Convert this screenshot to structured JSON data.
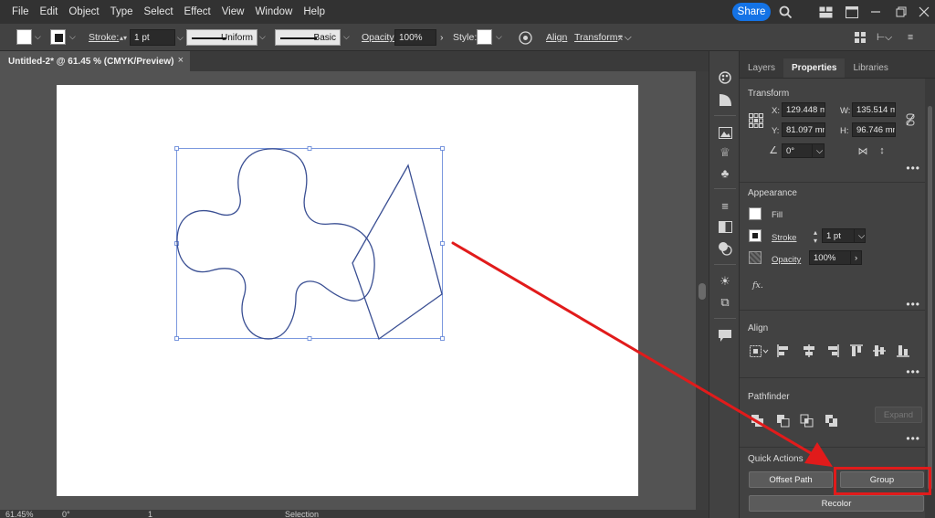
{
  "menu": {
    "items": [
      "File",
      "Edit",
      "Object",
      "Type",
      "Select",
      "Effect",
      "View",
      "Window",
      "Help"
    ],
    "share_label": "Share",
    "icons": [
      "search-icon",
      "arrange-documents-icon",
      "maximize-icon",
      "minimize-icon",
      "restore-icon",
      "close-icon"
    ]
  },
  "control_bar": {
    "stroke_label": "Stroke:",
    "stroke_weight": "1 pt",
    "profile": "Uniform",
    "brush": "Basic",
    "opacity_label": "Opacity:",
    "opacity_value": "100%",
    "style_label": "Style:",
    "align_label": "Align",
    "transform_label": "Transform"
  },
  "document": {
    "tab_title": "Untitled-2* @ 61.45 % (CMYK/Preview)",
    "close_glyph": "×"
  },
  "status_bar": {
    "zoom": "61.45%",
    "rotation": "0°",
    "artboard": "1",
    "tool": "Selection"
  },
  "panel": {
    "tabs": [
      "Layers",
      "Properties",
      "Libraries"
    ],
    "active_tab": "Properties",
    "transform": {
      "title": "Transform",
      "x_label": "X:",
      "x": "129.448 mi",
      "y_label": "Y:",
      "y": "81.097 mm",
      "w_label": "W:",
      "w": "135.514 m",
      "h_label": "H:",
      "h": "96.746 mm",
      "angle": "0°"
    },
    "appearance": {
      "title": "Appearance",
      "fill_label": "Fill",
      "stroke_label": "Stroke",
      "stroke_value": "1 pt",
      "opacity_label": "Opacity",
      "opacity_value": "100%",
      "fx_label": "fx."
    },
    "align": {
      "title": "Align"
    },
    "pathfinder": {
      "title": "Pathfinder",
      "expand_label": "Expand"
    },
    "quick_actions": {
      "title": "Quick Actions",
      "offset_path": "Offset Path",
      "group": "Group",
      "recolor": "Recolor"
    },
    "more_glyph": "•••"
  },
  "colors": {
    "menu_bg": "#323232",
    "panel_bg": "#424242",
    "canvas_bg": "#535353",
    "accent": "#1473e6",
    "shape_stroke": "#3a4f93",
    "selection": "#5b7fd6",
    "annotation": "#e11b1b"
  }
}
